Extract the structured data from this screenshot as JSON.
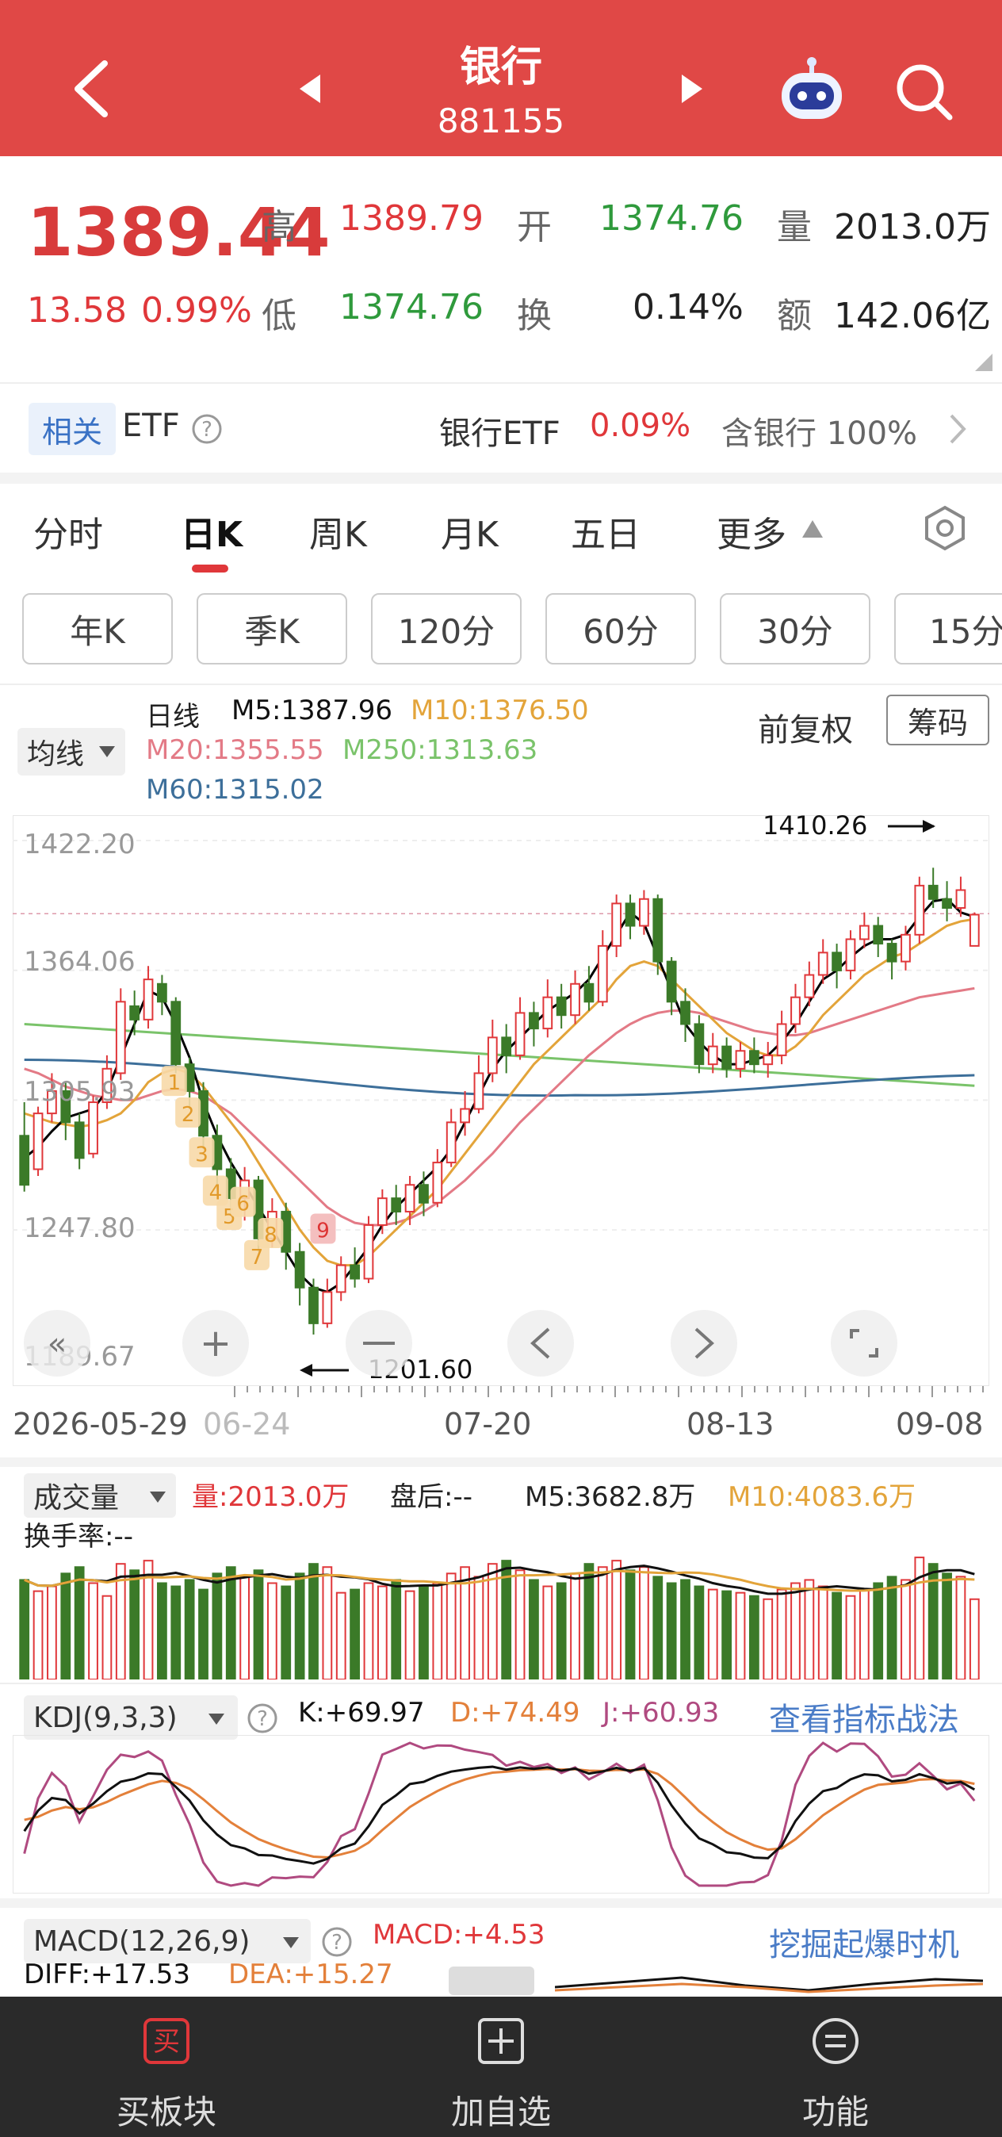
{
  "header": {
    "title": "银行",
    "code": "881155"
  },
  "quote": {
    "price": "1389.44",
    "change": "13.58",
    "change_pct": "0.99%",
    "high_label": "高",
    "high": "1389.79",
    "low_label": "低",
    "low": "1374.76",
    "open_label": "开",
    "open": "1374.76",
    "turnover_label": "换",
    "turnover": "0.14%",
    "volume_label": "量",
    "volume": "2013.0万",
    "amount_label": "额",
    "amount": "142.06亿"
  },
  "etf_bar": {
    "tag": "相关",
    "label": "ETF",
    "etf_name": "银行ETF",
    "etf_change": "0.09%",
    "contains": "含银行 100%"
  },
  "tabs": [
    "分时",
    "日K",
    "周K",
    "月K",
    "五日",
    "更多"
  ],
  "period_buttons": [
    "年K",
    "季K",
    "120分",
    "60分",
    "30分",
    "15分"
  ],
  "ma_legend": {
    "selector": "均线",
    "type": "日线",
    "m5": "M5:1387.96",
    "m10": "M10:1376.50",
    "m20": "M20:1355.55",
    "m250": "M250:1313.63",
    "m60": "M60:1315.02",
    "adjust": "前复权",
    "chips": "筹码"
  },
  "colors": {
    "up": "#e0373a",
    "down": "#3b7a28",
    "ma5": "#000000",
    "ma10": "#e3a43a",
    "ma20": "#e37a86",
    "ma60": "#3d6f9a",
    "ma250": "#7ac36a",
    "header": "#e04846"
  },
  "kline": {
    "y_ticks": [
      "1422.20",
      "1364.06",
      "1305.93",
      "1247.80",
      "1189.67"
    ],
    "max_label": "1410.26",
    "min_label": "1201.60",
    "x_ticks": [
      "2026-05-29",
      "06-24",
      "07-20",
      "08-13",
      "09-08"
    ],
    "signals_down": [
      "1",
      "2",
      "3",
      "4",
      "5",
      "6",
      "7",
      "8"
    ],
    "signal_up": "9"
  },
  "volume": {
    "selector": "成交量",
    "vol": "量:2013.0万",
    "after": "盘后:--",
    "m5": "M5:3682.8万",
    "m10": "M10:4083.6万",
    "turnover": "换手率:--"
  },
  "kdj": {
    "selector": "KDJ(9,3,3)",
    "k": "K:+69.97",
    "d": "D:+74.49",
    "j": "J:+60.93",
    "link": "查看指标战法"
  },
  "macd": {
    "selector": "MACD(12,26,9)",
    "macd": "MACD:+4.53",
    "diff": "DIFF:+17.53",
    "dea": "DEA:+15.27",
    "link": "挖掘起爆时机"
  },
  "bottom_bar": [
    "买板块",
    "加自选",
    "功能"
  ],
  "bottom_icon_labels": [
    "买",
    "+",
    "="
  ],
  "chart_data": {
    "type": "candlestick",
    "title": "银行 881155 日K",
    "y_axis_ticks": [
      1422.2,
      1364.06,
      1305.93,
      1247.8,
      1189.67
    ],
    "x_axis_ticks": [
      "2026-05-29",
      "06-24",
      "07-20",
      "08-13",
      "09-08"
    ],
    "candles": [
      [
        1290,
        1268,
        1305,
        1265
      ],
      [
        1275,
        1300,
        1303,
        1272
      ],
      [
        1300,
        1310,
        1318,
        1296
      ],
      [
        1310,
        1296,
        1314,
        1288
      ],
      [
        1296,
        1280,
        1300,
        1275
      ],
      [
        1282,
        1305,
        1308,
        1280
      ],
      [
        1305,
        1320,
        1326,
        1302
      ],
      [
        1318,
        1350,
        1356,
        1315
      ],
      [
        1348,
        1342,
        1355,
        1335
      ],
      [
        1342,
        1360,
        1366,
        1338
      ],
      [
        1358,
        1350,
        1362,
        1344
      ],
      [
        1350,
        1322,
        1352,
        1318
      ],
      [
        1322,
        1310,
        1325,
        1302
      ],
      [
        1310,
        1290,
        1314,
        1284
      ],
      [
        1290,
        1275,
        1295,
        1266
      ],
      [
        1275,
        1262,
        1280,
        1255
      ],
      [
        1262,
        1270,
        1276,
        1252
      ],
      [
        1270,
        1244,
        1272,
        1238
      ],
      [
        1244,
        1256,
        1262,
        1240
      ],
      [
        1256,
        1238,
        1260,
        1230
      ],
      [
        1238,
        1222,
        1242,
        1214
      ],
      [
        1222,
        1206,
        1226,
        1201
      ],
      [
        1206,
        1220,
        1226,
        1204
      ],
      [
        1220,
        1232,
        1236,
        1216
      ],
      [
        1232,
        1226,
        1240,
        1222
      ],
      [
        1226,
        1250,
        1254,
        1224
      ],
      [
        1250,
        1262,
        1266,
        1246
      ],
      [
        1262,
        1256,
        1268,
        1250
      ],
      [
        1256,
        1268,
        1272,
        1250
      ],
      [
        1268,
        1260,
        1274,
        1254
      ],
      [
        1260,
        1278,
        1284,
        1258
      ],
      [
        1278,
        1296,
        1302,
        1276
      ],
      [
        1296,
        1302,
        1310,
        1290
      ],
      [
        1302,
        1318,
        1326,
        1300
      ],
      [
        1318,
        1334,
        1342,
        1314
      ],
      [
        1334,
        1326,
        1340,
        1318
      ],
      [
        1326,
        1345,
        1352,
        1324
      ],
      [
        1345,
        1338,
        1350,
        1330
      ],
      [
        1338,
        1352,
        1360,
        1334
      ],
      [
        1352,
        1344,
        1358,
        1338
      ],
      [
        1344,
        1358,
        1364,
        1340
      ],
      [
        1358,
        1350,
        1366,
        1346
      ],
      [
        1350,
        1375,
        1382,
        1348
      ],
      [
        1375,
        1394,
        1398,
        1370
      ],
      [
        1394,
        1384,
        1398,
        1378
      ],
      [
        1384,
        1396,
        1400,
        1380
      ],
      [
        1396,
        1368,
        1398,
        1362
      ],
      [
        1368,
        1350,
        1370,
        1344
      ],
      [
        1350,
        1340,
        1356,
        1332
      ],
      [
        1340,
        1322,
        1344,
        1318
      ],
      [
        1322,
        1330,
        1336,
        1318
      ],
      [
        1330,
        1320,
        1334,
        1316
      ],
      [
        1320,
        1328,
        1332,
        1316
      ],
      [
        1328,
        1322,
        1334,
        1318
      ],
      [
        1322,
        1326,
        1332,
        1316
      ],
      [
        1326,
        1340,
        1346,
        1322
      ],
      [
        1340,
        1352,
        1358,
        1336
      ],
      [
        1352,
        1362,
        1368,
        1348
      ],
      [
        1362,
        1372,
        1378,
        1358
      ],
      [
        1372,
        1364,
        1376,
        1356
      ],
      [
        1364,
        1378,
        1382,
        1360
      ],
      [
        1378,
        1384,
        1390,
        1374
      ],
      [
        1384,
        1376,
        1388,
        1370
      ],
      [
        1376,
        1368,
        1378,
        1360
      ],
      [
        1368,
        1380,
        1384,
        1364
      ],
      [
        1380,
        1402,
        1406,
        1376
      ],
      [
        1402,
        1396,
        1410,
        1392
      ],
      [
        1396,
        1392,
        1404,
        1386
      ],
      [
        1392,
        1400,
        1406,
        1388
      ],
      [
        1375,
        1389,
        1390,
        1375
      ]
    ],
    "volumes": [
      62,
      55,
      58,
      66,
      70,
      60,
      52,
      72,
      68,
      74,
      60,
      58,
      62,
      56,
      66,
      70,
      64,
      68,
      60,
      58,
      66,
      72,
      70,
      54,
      56,
      60,
      58,
      62,
      55,
      58,
      60,
      66,
      70,
      64,
      72,
      74,
      68,
      62,
      58,
      60,
      66,
      72,
      70,
      74,
      68,
      70,
      64,
      60,
      62,
      58,
      56,
      55,
      54,
      52,
      50,
      56,
      60,
      62,
      58,
      54,
      52,
      56,
      60,
      64,
      62,
      76,
      72,
      66,
      64,
      50
    ],
    "ma5": [
      1280,
      1285,
      1292,
      1298,
      1300,
      1302,
      1310,
      1325,
      1340,
      1355,
      1352,
      1340,
      1325,
      1305,
      1290,
      1278,
      1268,
      1258,
      1248,
      1238,
      1228,
      1222,
      1220,
      1224,
      1232,
      1240,
      1250,
      1258,
      1264,
      1270,
      1276,
      1284,
      1296,
      1308,
      1320,
      1328,
      1334,
      1340,
      1346,
      1350,
      1354,
      1360,
      1370,
      1380,
      1390,
      1385,
      1370,
      1355,
      1340,
      1332,
      1326,
      1322,
      1322,
      1324,
      1326,
      1332,
      1340,
      1350,
      1360,
      1364,
      1370,
      1375,
      1378,
      1378,
      1380,
      1388,
      1395,
      1396,
      1390,
      1388
    ],
    "ma10": [
      1300,
      1298,
      1296,
      1295,
      1294,
      1295,
      1297,
      1300,
      1306,
      1314,
      1318,
      1320,
      1318,
      1312,
      1304,
      1296,
      1288,
      1278,
      1268,
      1258,
      1248,
      1240,
      1234,
      1232,
      1232,
      1236,
      1242,
      1248,
      1254,
      1260,
      1266,
      1274,
      1282,
      1290,
      1298,
      1306,
      1314,
      1322,
      1328,
      1334,
      1340,
      1346,
      1352,
      1360,
      1366,
      1368,
      1366,
      1360,
      1354,
      1348,
      1342,
      1336,
      1332,
      1328,
      1326,
      1326,
      1330,
      1336,
      1344,
      1350,
      1356,
      1362,
      1366,
      1370,
      1372,
      1376,
      1380,
      1384,
      1386,
      1387
    ],
    "ma20": [
      1320,
      1318,
      1315,
      1312,
      1310,
      1308,
      1307,
      1306,
      1306,
      1308,
      1310,
      1311,
      1310,
      1308,
      1304,
      1300,
      1294,
      1288,
      1282,
      1276,
      1270,
      1264,
      1258,
      1254,
      1251,
      1250,
      1250,
      1251,
      1253,
      1256,
      1260,
      1265,
      1270,
      1276,
      1282,
      1289,
      1296,
      1302,
      1308,
      1314,
      1320,
      1326,
      1331,
      1336,
      1340,
      1343,
      1345,
      1346,
      1346,
      1345,
      1343,
      1341,
      1339,
      1337,
      1336,
      1335,
      1335,
      1336,
      1338,
      1340,
      1342,
      1344,
      1346,
      1348,
      1350,
      1352,
      1353,
      1354,
      1355,
      1356
    ]
  }
}
